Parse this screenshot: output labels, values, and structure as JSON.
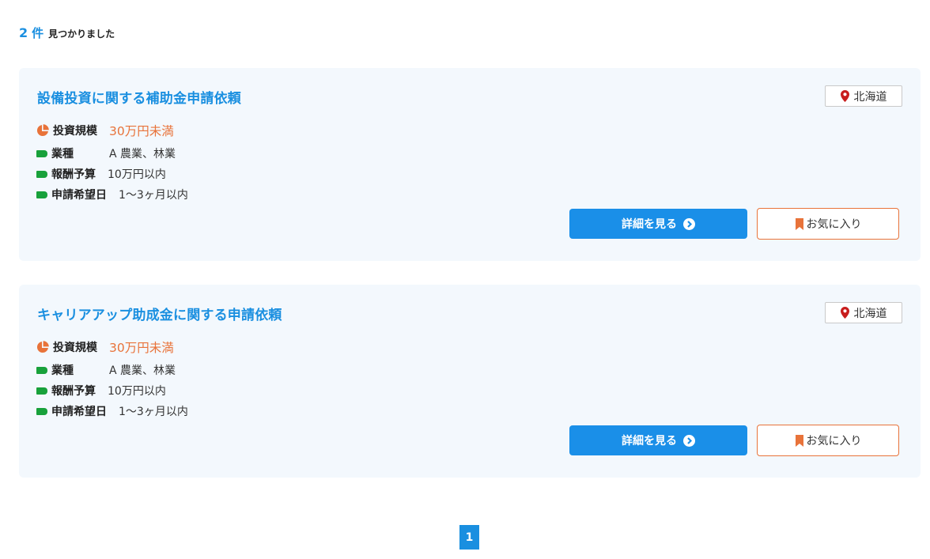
{
  "results": {
    "count": "2",
    "unit": "件",
    "found_text": "見つかりました"
  },
  "colors": {
    "accent": "#1a8fe0",
    "orange": "#e8733a",
    "tag_green": "#18a13b",
    "pin_red": "#c81d1d"
  },
  "cards": [
    {
      "title": "設備投資に関する補助金申請依頼",
      "location": "北海道",
      "investment_label": "投資規模",
      "investment_value": "30万円未満",
      "industry_label": "業種",
      "industry_value": "A 農業、林業",
      "budget_label": "報酬予算",
      "budget_value": "10万円以内",
      "date_label": "申請希望日",
      "date_value": "1〜3ヶ月以内",
      "detail_button": "詳細を見る",
      "favorite_button": "お気に入り"
    },
    {
      "title": "キャリアアップ助成金に関する申請依頼",
      "location": "北海道",
      "investment_label": "投資規模",
      "investment_value": "30万円未満",
      "industry_label": "業種",
      "industry_value": "A 農業、林業",
      "budget_label": "報酬予算",
      "budget_value": "10万円以内",
      "date_label": "申請希望日",
      "date_value": "1〜3ヶ月以内",
      "detail_button": "詳細を見る",
      "favorite_button": "お気に入り"
    }
  ],
  "pagination": {
    "current_page": "1"
  },
  "icons": {
    "investment": "pie-chart-icon",
    "row_tag": "tag-icon",
    "location": "map-pin-icon",
    "detail": "chevron-circle-right-icon",
    "favorite": "bookmark-icon"
  }
}
